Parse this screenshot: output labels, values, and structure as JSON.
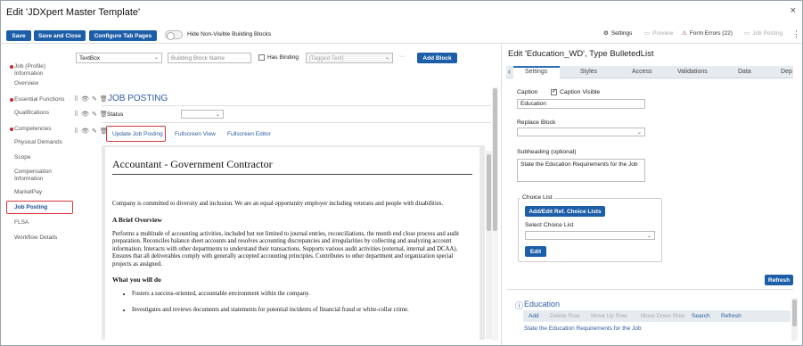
{
  "window": {
    "title": "Edit 'JDXpert Master Template'",
    "close_glyph": "×"
  },
  "toolbar": {
    "save": "Save",
    "save_close": "Save and Close",
    "configure_tabs": "Configure Tab Pages",
    "hide_toggle_label": "Hide Non-Visible Building Blocks",
    "settings": "Settings",
    "preview": "Preview",
    "form_errors": "Form Errors (22)",
    "job_posting": "Job Posting",
    "more": "⋮"
  },
  "nav": {
    "items": [
      {
        "label": "Job (Profile) Information",
        "error": true
      },
      {
        "label": "Overview",
        "error": false
      },
      {
        "label": "Essential Functions",
        "error": true
      },
      {
        "label": "Qualifications",
        "error": false
      },
      {
        "label": "Competencies",
        "error": true
      },
      {
        "label": "Physical Demands",
        "error": false
      },
      {
        "label": "Scope",
        "error": false
      },
      {
        "label": "Compensation Information",
        "error": false
      },
      {
        "label": "MarketPay",
        "error": false
      },
      {
        "label": "Job Posting",
        "error": false,
        "active": true
      },
      {
        "label": "FLSA",
        "error": false
      },
      {
        "label": "Workflow Details",
        "error": false
      }
    ]
  },
  "builder": {
    "type_select": "TextBox",
    "name_placeholder": "Building Block Name",
    "has_binding": "Has Binding",
    "tagged_text_placeholder": "[Tagged Text]",
    "ellipsis": "···",
    "add_block": "Add Block",
    "section_title": "JOB POSTING",
    "status_label": "Status",
    "links": {
      "update": "Update Job Posting",
      "fullscreen_view": "Fullscreen View",
      "fullscreen_editor": "Fullscreen Editor"
    }
  },
  "document": {
    "heading": "Accountant - Government Contractor",
    "intro": "Company is committed to diversity and inclusion. We are an equal opportunity employer including veterans and people with disabilities.",
    "brief_heading": "A Brief Overview",
    "brief_body": "Performs a multitude of accounting activities, included but not limited to journal entries, reconciliations, the month end close process and audit preparation. Reconciles balance sheet accounts and resolves accounting discrepancies and irregularities by collecting and analyzing account information. Interacts with other departments to understand their transactions. Supports various audit activities (external, internal and DCAA). Ensures that all deliverables comply with generally accepted accounting principles. Contributes to other department and organization special projects as assigned.",
    "will_do_heading": "What you will do",
    "bullets": [
      "Fosters a success-oriented, accountable environment within the company.",
      "Investigates and reviews documents and statements for potential incidents of financial fraud or white-collar crime."
    ]
  },
  "panel": {
    "title": "Edit 'Education_WD', Type BulletedList",
    "tabs": [
      "Settings",
      "Styles",
      "Access",
      "Validations",
      "Data",
      "Dep"
    ],
    "caption_label": "Caption",
    "caption_visible": "Caption Visible",
    "caption_value": "Education",
    "replace_block": "Replace Block",
    "subheading_label": "Subheading (optional)",
    "subheading_value": "State the Education Requirements for the Job",
    "choice_list_label": "Choice List",
    "add_edit_btn": "Add/Edit Ref. Choice Lists",
    "select_choice_list": "Select Choice List",
    "edit_btn": "Edit",
    "refresh_btn": "Refresh",
    "preview_title": "Education",
    "grid_actions": [
      "Add",
      "Delete Row",
      "Move Up Row",
      "Move Down Row",
      "Search",
      "Refresh"
    ],
    "grid_first_row": "State the Education Requirements for the Job"
  },
  "colors": {
    "primary": "#1d5ea8",
    "error": "#c0292e",
    "link": "#2b5d9e"
  }
}
